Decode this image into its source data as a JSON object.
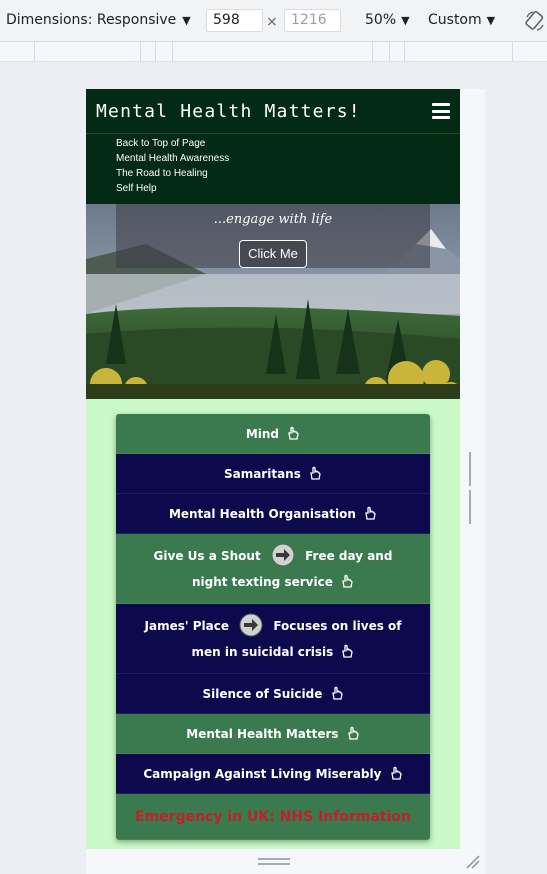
{
  "devtools": {
    "dimensions_label": "Dimensions: Responsive",
    "width_value": "598",
    "height_value": "1216",
    "times": "×",
    "zoom": "50%",
    "throttle": "Custom"
  },
  "site": {
    "brand": "Mental Health Matters!",
    "nav_items": [
      "Back to Top of Page",
      "Mental Health Awareness",
      "The Road to Healing",
      "Self Help"
    ],
    "tagline": "...engage with life",
    "hero_button": "Click Me"
  },
  "links": [
    {
      "label": "Mind",
      "style": "green"
    },
    {
      "label": "Samaritans",
      "style": "navy"
    },
    {
      "label": "Mental Health Organisation",
      "style": "navy"
    },
    {
      "label": "Give Us a Shout",
      "extra": "Free day and night texting service",
      "style": "green"
    },
    {
      "label": "James' Place",
      "extra": "Focuses on lives of men in suicidal crisis",
      "style": "navy"
    },
    {
      "label": "Silence of Suicide",
      "style": "navy"
    },
    {
      "label": "Mental Health Matters",
      "style": "green"
    },
    {
      "label": "Campaign Against Living Miserably",
      "style": "navy"
    },
    {
      "label": "Emergency in UK: NHS Information",
      "style": "emergency"
    }
  ],
  "colors": {
    "nav_bg": "#032a14",
    "green": "#3b7a4f",
    "navy": "#0c0a4d",
    "emergency_text": "#c0202a",
    "page_bg": "#c9f9c6"
  },
  "icons": [
    "hand-pointer-icon",
    "arrow-circle-right-icon",
    "hamburger-menu-icon",
    "rotate-icon"
  ]
}
